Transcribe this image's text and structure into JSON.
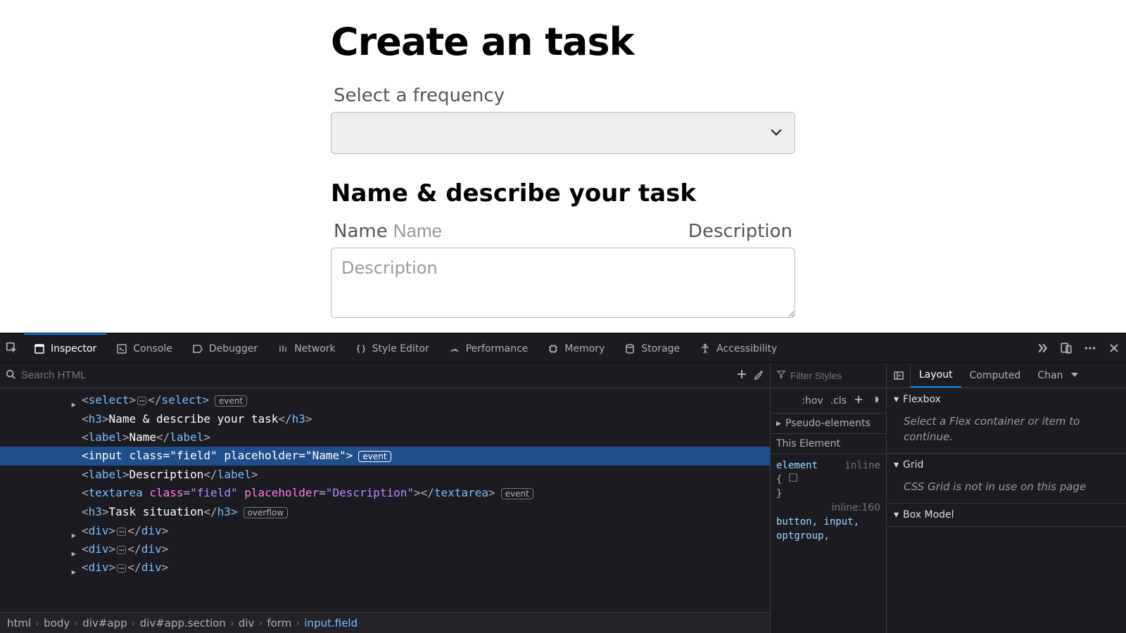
{
  "page": {
    "title": "Create an task",
    "frequency_label": "Select a frequency",
    "frequency_value": "",
    "section_heading": "Name & describe your task",
    "name_label": "Name",
    "name_placeholder": "Name",
    "name_value": "",
    "desc_label": "Description",
    "desc_placeholder": "Description",
    "desc_value": ""
  },
  "devtools": {
    "tabs": [
      "Inspector",
      "Console",
      "Debugger",
      "Network",
      "Style Editor",
      "Performance",
      "Memory",
      "Storage",
      "Accessibility"
    ],
    "active_tab": "Inspector",
    "search_placeholder": "Search HTML",
    "tree": {
      "select_badge": "event",
      "h3_1_text": "Name & describe your task",
      "label_name": "Name",
      "input_line_prefix": "<input class=\"field\" placeholder=\"Name\">",
      "input_badge": "event",
      "label_desc": "Description",
      "textarea_attr_class": "field",
      "textarea_attr_placeholder": "Description",
      "textarea_badge": "event",
      "h3_2_text": "Task situation",
      "h3_2_badge": "overflow"
    },
    "breadcrumb": [
      "html",
      "body",
      "div#app",
      "div#app.section",
      "div",
      "form",
      "input.field"
    ],
    "styles": {
      "filter_placeholder": "Filter Styles",
      "hov": ":hov",
      "cls": ".cls",
      "pseudo_label": "Pseudo-elements",
      "this_element": "This Element",
      "rule_selector": "element",
      "rule_inline": "inline",
      "rule_src": "inline:160",
      "rule_tail": "button, input, optgroup,"
    },
    "layout": {
      "tabs": [
        "Layout",
        "Computed",
        "Chan"
      ],
      "active": "Layout",
      "flexbox_title": "Flexbox",
      "flexbox_body": "Select a Flex container or item to continue.",
      "grid_title": "Grid",
      "grid_body": "CSS Grid is not in use on this page",
      "boxmodel_title": "Box Model"
    }
  }
}
